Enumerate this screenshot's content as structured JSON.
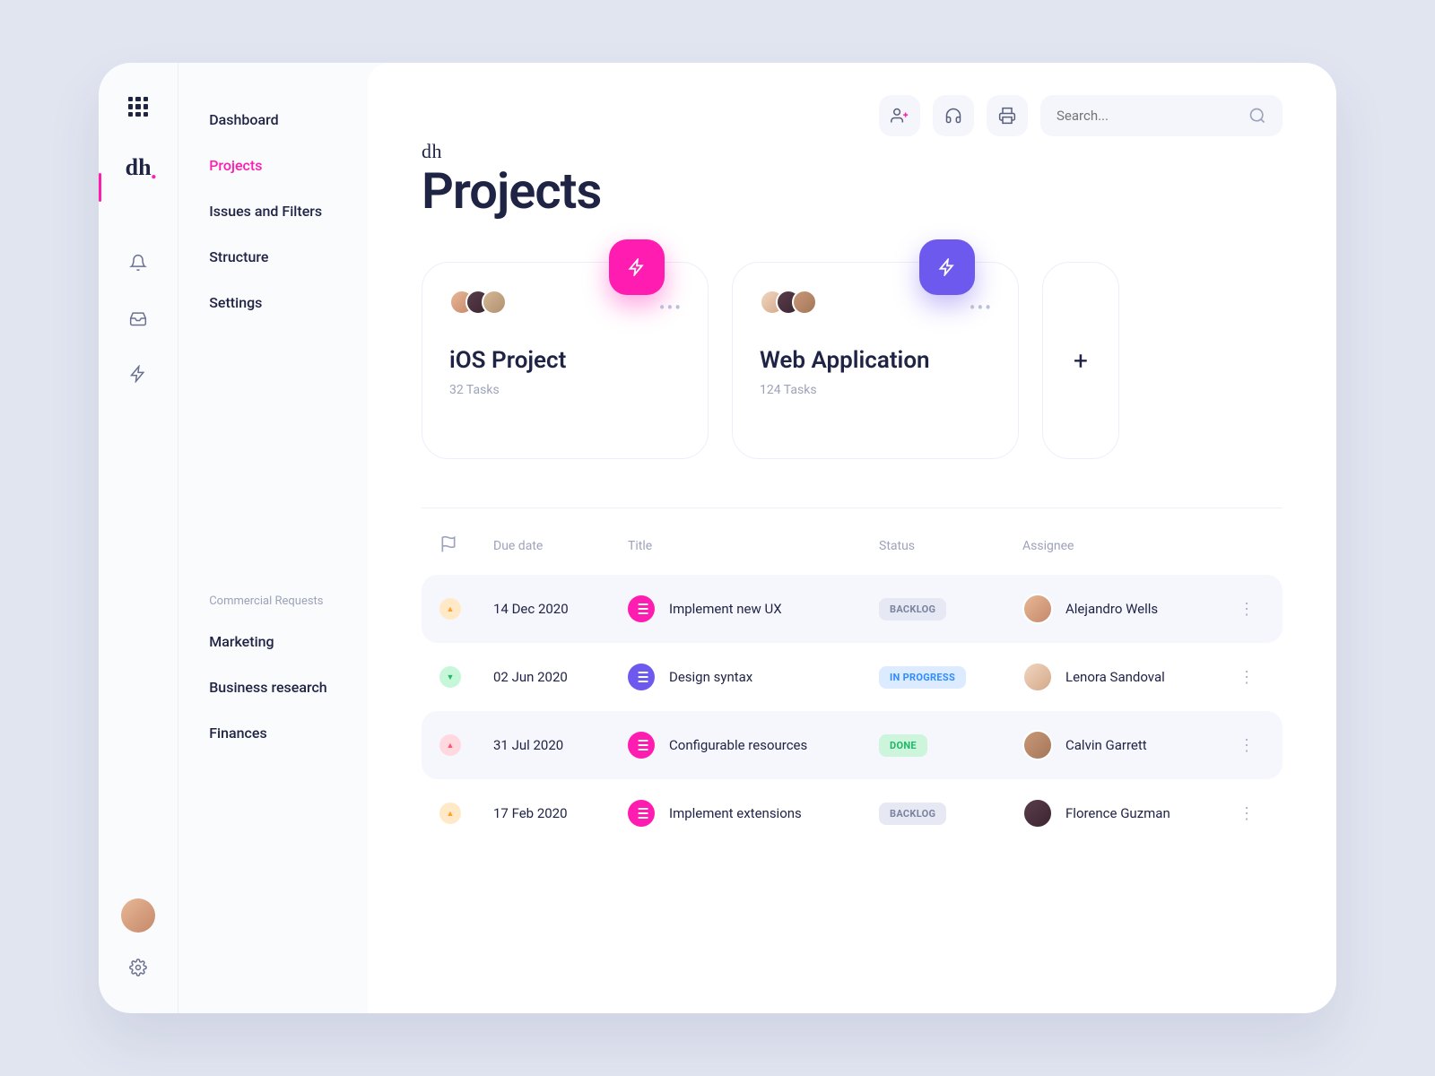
{
  "brand": "dh",
  "title": "Projects",
  "search": {
    "placeholder": "Search..."
  },
  "rail": {},
  "nav": {
    "items": [
      {
        "label": "Dashboard"
      },
      {
        "label": "Projects",
        "active": true
      },
      {
        "label": "Issues and Filters"
      },
      {
        "label": "Structure"
      },
      {
        "label": "Settings"
      }
    ]
  },
  "commercial": {
    "label": "Commercial Requests",
    "items": [
      {
        "label": "Marketing"
      },
      {
        "label": "Business research"
      },
      {
        "label": "Finances"
      }
    ]
  },
  "cards": [
    {
      "title": "iOS Project",
      "sub": "32 Tasks",
      "color": "pink"
    },
    {
      "title": "Web Application",
      "sub": "124 Tasks",
      "color": "purple"
    }
  ],
  "table": {
    "headers": {
      "flag": "",
      "due": "Due date",
      "title": "Title",
      "status": "Status",
      "assignee": "Assignee"
    },
    "rows": [
      {
        "flag": "orange",
        "flagdir": "up",
        "due": "14 Dec 2020",
        "title": "Implement new UX",
        "icon": "pink",
        "status": "BACKLOG",
        "statusClass": "st-backlog",
        "assignee": "Alejandro Wells",
        "striped": true
      },
      {
        "flag": "green",
        "flagdir": "down",
        "due": "02 Jun 2020",
        "title": "Design syntax",
        "icon": "purple",
        "status": "IN PROGRESS",
        "statusClass": "st-progress",
        "assignee": "Lenora Sandoval",
        "striped": false
      },
      {
        "flag": "pink",
        "flagdir": "up",
        "due": "31 Jul 2020",
        "title": "Configurable resources",
        "icon": "pink",
        "status": "DONE",
        "statusClass": "st-done",
        "assignee": "Calvin Garrett",
        "striped": true
      },
      {
        "flag": "orange",
        "flagdir": "up",
        "due": "17 Feb 2020",
        "title": "Implement extensions",
        "icon": "pink",
        "status": "BACKLOG",
        "statusClass": "st-backlog",
        "assignee": "Florence Guzman",
        "striped": false
      }
    ]
  }
}
